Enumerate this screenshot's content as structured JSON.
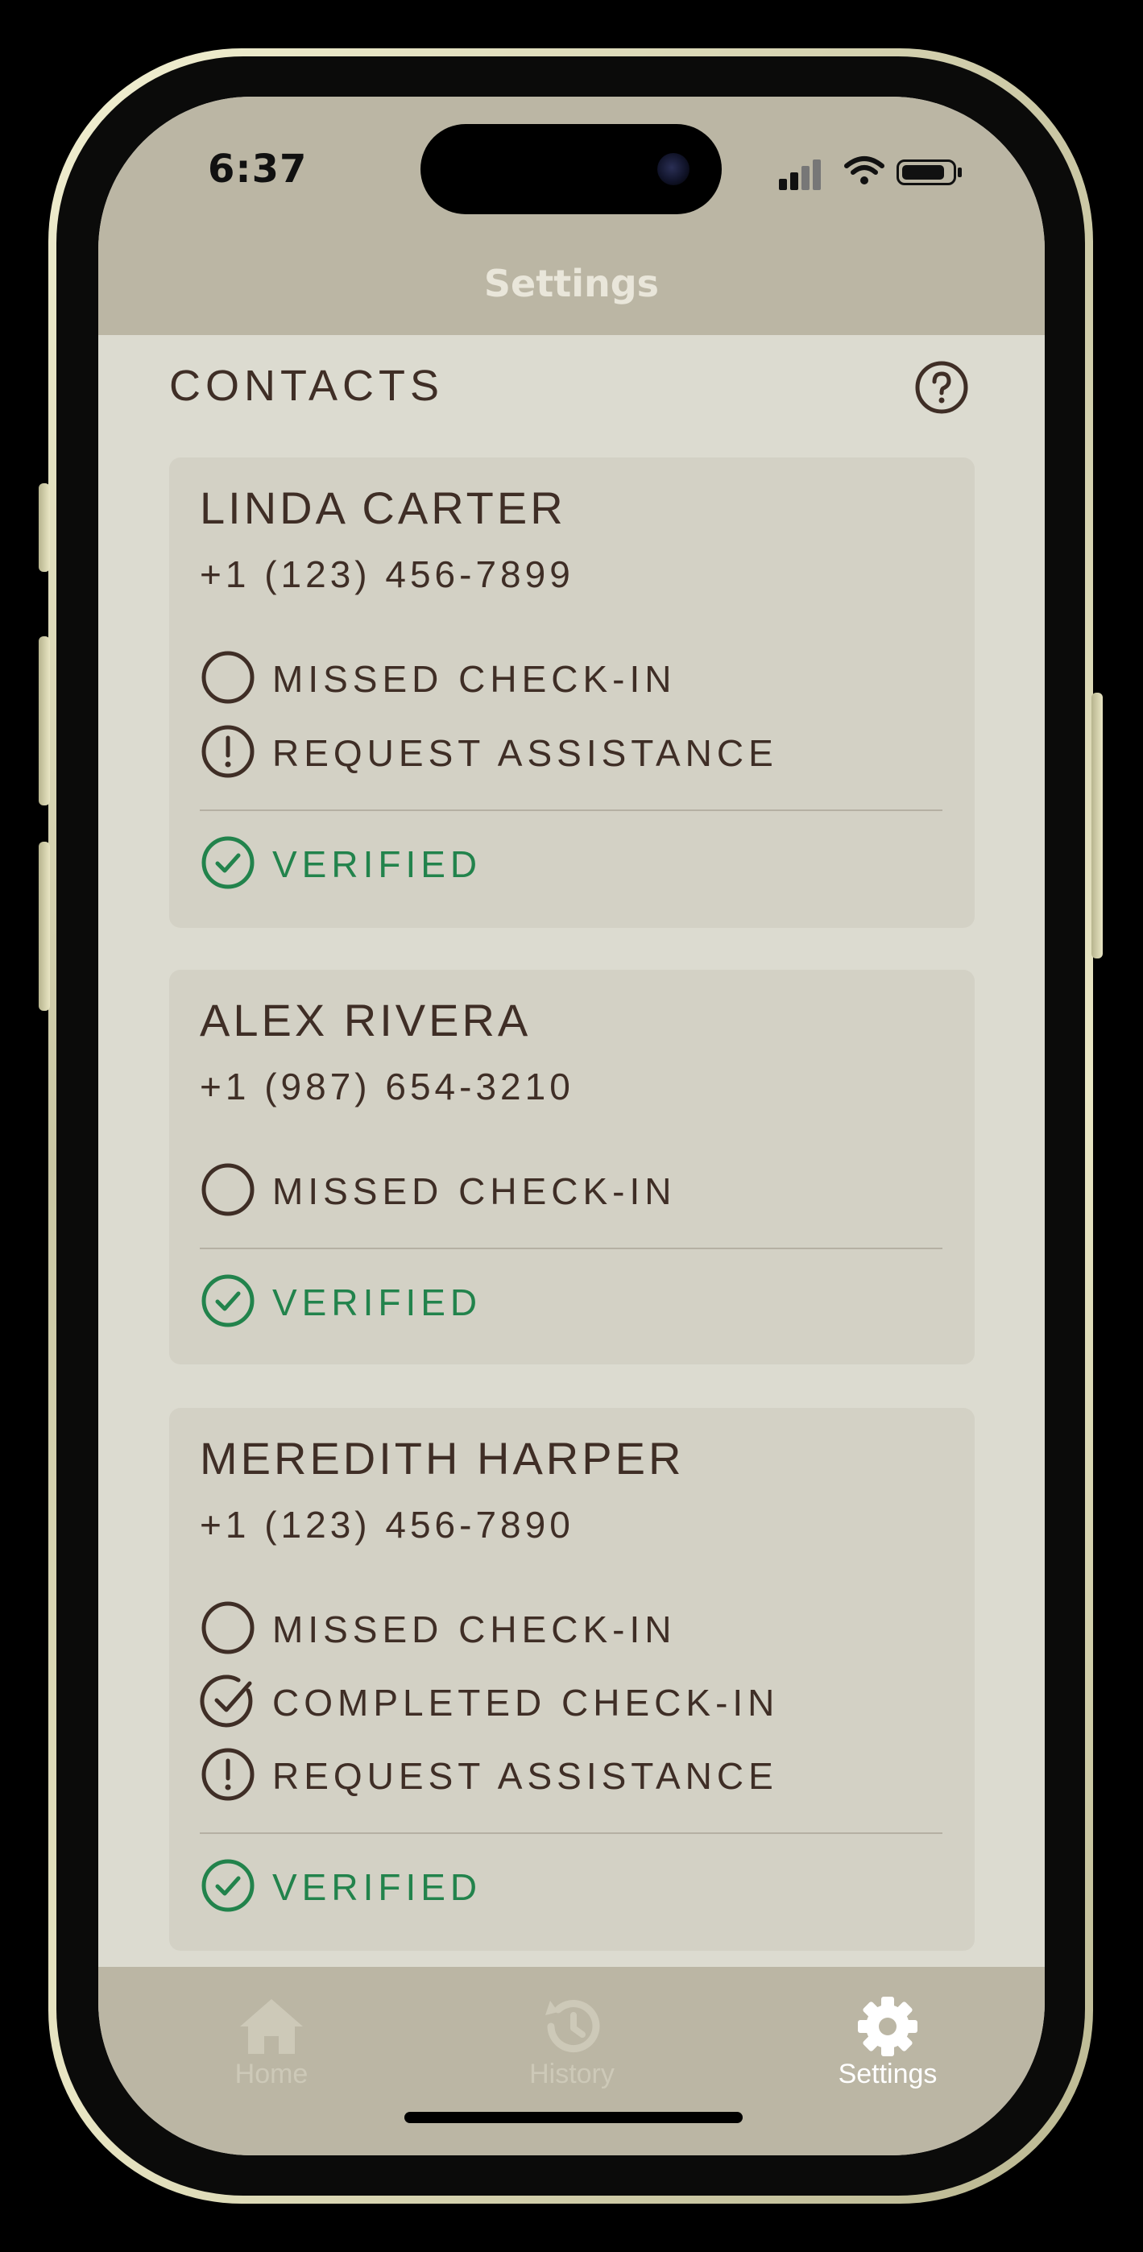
{
  "status_bar": {
    "time": "6:37"
  },
  "nav": {
    "title": "Settings"
  },
  "contacts": {
    "header": "CONTACTS",
    "help_icon": "question-circle-icon",
    "cards": [
      {
        "name": "LINDA CARTER",
        "phone": "+1 (123) 456-7899",
        "options": [
          {
            "icon": "circle-outline-icon",
            "label": "MISSED CHECK-IN"
          },
          {
            "icon": "exclamation-circle-icon",
            "label": "REQUEST ASSISTANCE"
          }
        ],
        "verified": "VERIFIED"
      },
      {
        "name": "ALEX RIVERA",
        "phone": "+1 (987) 654-3210",
        "options": [
          {
            "icon": "circle-outline-icon",
            "label": "MISSED CHECK-IN"
          }
        ],
        "verified": "VERIFIED"
      },
      {
        "name": "MEREDITH HARPER",
        "phone": "+1 (123) 456-7890",
        "options": [
          {
            "icon": "circle-outline-icon",
            "label": "MISSED CHECK-IN"
          },
          {
            "icon": "check-circle-icon",
            "label": "COMPLETED CHECK-IN"
          },
          {
            "icon": "exclamation-circle-icon",
            "label": "REQUEST ASSISTANCE"
          }
        ],
        "verified": "VERIFIED"
      }
    ]
  },
  "tab_bar": {
    "tabs": [
      {
        "label": "Home",
        "icon": "home-icon",
        "active": false
      },
      {
        "label": "History",
        "icon": "history-icon",
        "active": false
      },
      {
        "label": "Settings",
        "icon": "gear-icon",
        "active": true
      }
    ]
  },
  "colors": {
    "header_bg": "#bbb6a4",
    "screen_bg": "#dcdbd0",
    "card_bg": "#d3d1c5",
    "text": "#3f2e26",
    "verified": "#22834c"
  }
}
